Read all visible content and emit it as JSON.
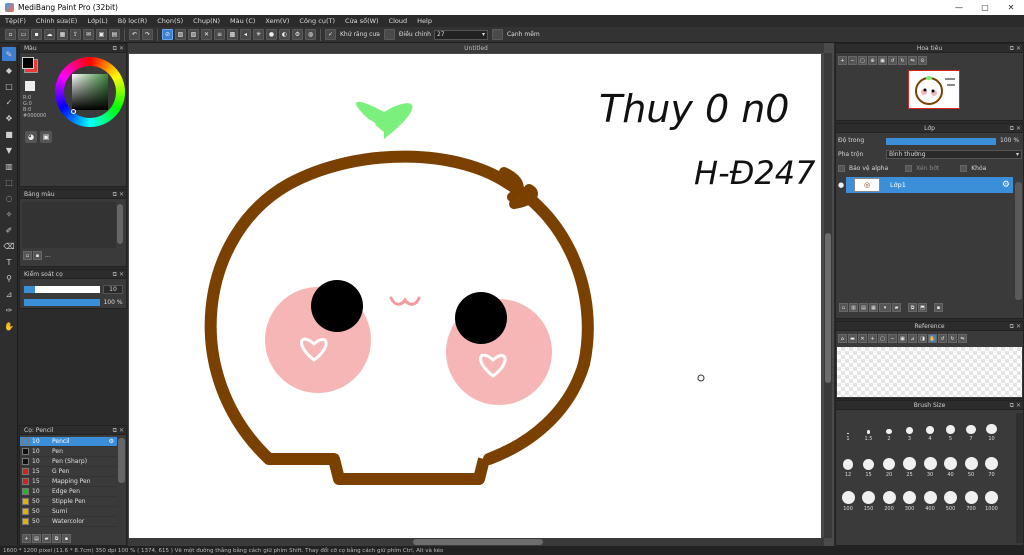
{
  "window": {
    "title": "MediBang Paint Pro (32bit)",
    "minimize": "—",
    "maximize": "▢",
    "close": "✕"
  },
  "menu": [
    "Tệp(F)",
    "Chỉnh sửa(E)",
    "Lớp(L)",
    "Bộ lọc(R)",
    "Chọn(S)",
    "Chụp(N)",
    "Màu (C)",
    "Xem(V)",
    "Công cụ(T)",
    "Cửa sổ(W)",
    "Cloud",
    "Help"
  ],
  "toolbar": {
    "antialias_label": "Khử răng cưa",
    "adjust_label": "Điều chỉnh",
    "adjust_value": "27",
    "edge_label": "Cạnh mềm"
  },
  "color_panel": {
    "title": "Màu",
    "rgb": [
      "0",
      "0",
      "0"
    ],
    "rgb_labels": [
      "R:",
      "G:",
      "B:"
    ],
    "hex": "#000000",
    "primary_color": "#000000",
    "secondary_color": "#e83a3a"
  },
  "palette_panel": {
    "title": "Bảng màu",
    "more": "..."
  },
  "brush_control": {
    "title": "Kiểm soát cọ",
    "size": "10",
    "opacity": "100 %"
  },
  "brush_panel": {
    "title": "Cọ: Pencil",
    "items": [
      {
        "size": "10",
        "name": "Pencil",
        "color": "#3b8fd9",
        "selected": true
      },
      {
        "size": "10",
        "name": "Pen",
        "color": "#111111"
      },
      {
        "size": "10",
        "name": "Pen (Sharp)",
        "color": "#111111"
      },
      {
        "size": "15",
        "name": "G Pen",
        "color": "#d42020"
      },
      {
        "size": "15",
        "name": "Mapping Pen",
        "color": "#d42020"
      },
      {
        "size": "10",
        "name": "Edge Pen",
        "color": "#28b428"
      },
      {
        "size": "50",
        "name": "Stipple Pen",
        "color": "#e0b010"
      },
      {
        "size": "50",
        "name": "Sumi",
        "color": "#e0b010"
      },
      {
        "size": "50",
        "name": "Watercolor",
        "color": "#e0b010"
      }
    ]
  },
  "canvas": {
    "tab": "Untitled",
    "handwriting_line1": "Thuy 0 n0",
    "handwriting_line2": "H-Đ247"
  },
  "navigator": {
    "title": "Hoa tiêu"
  },
  "layer_panel": {
    "title": "Lớp",
    "opacity_label": "Độ trong",
    "opacity_value": "100 %",
    "blend_label": "Pha trộn",
    "blend_value": "Bình thường",
    "protect_alpha": "Bảo vệ alpha",
    "clipping": "Xén bớt",
    "lock": "Khóa",
    "layer_name": "Lớp1"
  },
  "reference_panel": {
    "title": "Reference"
  },
  "brush_size_panel": {
    "title": "Brush Size",
    "sizes": [
      "1",
      "1.5",
      "2",
      "3",
      "4",
      "5",
      "7",
      "10",
      "12",
      "15",
      "20",
      "25",
      "30",
      "40",
      "50",
      "70",
      "100",
      "150",
      "200",
      "300",
      "400",
      "500",
      "700",
      "1000"
    ]
  },
  "status": "1600 * 1200 pixel   (11.6 * 8.7cm)   350 dpi   100 %   ( 1374, 615 )   Vẽ một đường thẳng bằng cách giữ phím Shift. Thay đổi cỡ cọ bằng cách giữ phím Ctrl, Alt và kéo"
}
